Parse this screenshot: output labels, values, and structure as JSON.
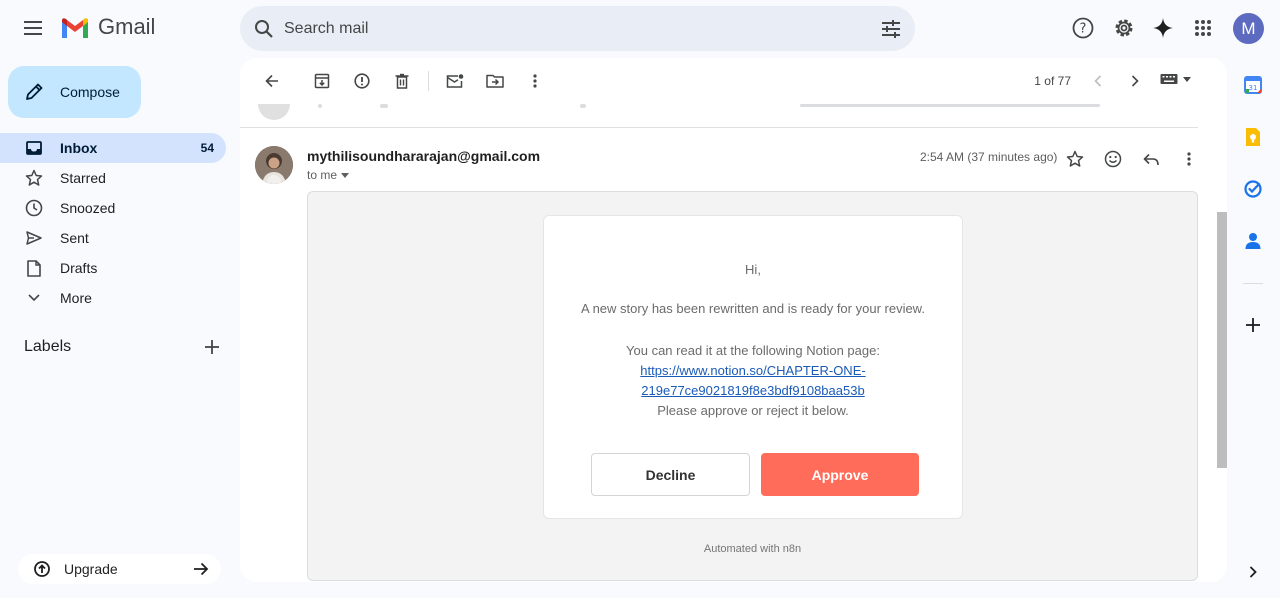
{
  "app": {
    "name": "Gmail",
    "avatar_letter": "M"
  },
  "search": {
    "placeholder": "Search mail"
  },
  "sidebar": {
    "compose_label": "Compose",
    "items": [
      {
        "label": "Inbox",
        "count": "54"
      },
      {
        "label": "Starred",
        "count": ""
      },
      {
        "label": "Snoozed",
        "count": ""
      },
      {
        "label": "Sent",
        "count": ""
      },
      {
        "label": "Drafts",
        "count": ""
      },
      {
        "label": "More",
        "count": ""
      }
    ],
    "labels_heading": "Labels",
    "upgrade_label": "Upgrade"
  },
  "toolbar": {
    "pager": "1 of 77"
  },
  "message": {
    "sender": "mythilisoundhararajan@gmail.com",
    "recipient": "to me",
    "timestamp": "2:54 AM (37 minutes ago)",
    "greeting": "Hi,",
    "line1": "A new story has been rewritten and is ready for your review.",
    "line2": "You can read it at the following Notion page:",
    "link_part1": "https://www.notion.so/CHAPTER-ONE-",
    "link_part2": "219e77ce9021819f8e3bdf9108baa53b",
    "line3": "Please approve or reject it below.",
    "decline_label": "Decline",
    "approve_label": "Approve",
    "footer": "Automated with n8n"
  },
  "colors": {
    "compose_bg": "#c2e7ff",
    "active_nav_bg": "#d3e3fd",
    "approve_bg": "#ff6d5a",
    "avatar_bg": "#5c6bc0",
    "link": "#1a5bb8"
  },
  "icons": {
    "top": [
      "menu-icon",
      "help-icon",
      "settings-icon",
      "gemini-sparkle-icon",
      "apps-grid-icon"
    ],
    "toolbar": [
      "back-arrow-icon",
      "archive-icon",
      "report-spam-icon",
      "delete-icon",
      "mark-unread-icon",
      "move-to-icon",
      "more-vert-icon",
      "chevron-left-icon",
      "chevron-right-icon",
      "keyboard-icon"
    ],
    "side_panel": [
      "calendar-icon",
      "keep-icon",
      "tasks-icon",
      "contacts-icon",
      "add-icon",
      "expand-panel-icon"
    ]
  }
}
